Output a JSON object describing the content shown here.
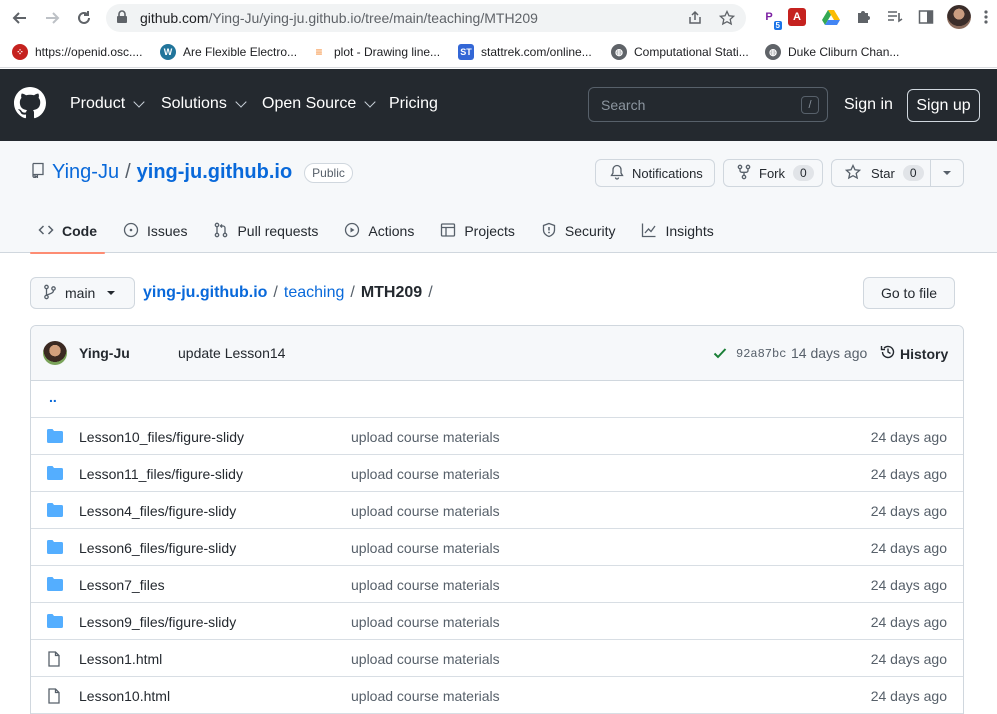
{
  "browser": {
    "url_host": "github.com",
    "url_path": "/Ying-Ju/ying-ju.github.io/tree/main/teaching/MTH209",
    "extension_badge": "5",
    "bookmarks": [
      {
        "label": "https://openid.osc....",
        "icon": "openid-icon",
        "color": "#c5221f"
      },
      {
        "label": "Are Flexible Electro...",
        "icon": "wordpress-icon",
        "color": "#21759b"
      },
      {
        "label": "plot - Drawing line...",
        "icon": "stackexchange-icon",
        "color": "#f48024"
      },
      {
        "label": "stattrek.com/online...",
        "icon": "stattrek-icon",
        "color": "#3367d6"
      },
      {
        "label": "Computational Stati...",
        "icon": "globe-icon",
        "color": "#5f6368"
      },
      {
        "label": "Duke Cliburn Chan...",
        "icon": "globe-icon",
        "color": "#5f6368"
      }
    ]
  },
  "header": {
    "nav": [
      "Product",
      "Solutions",
      "Open Source",
      "Pricing"
    ],
    "search_placeholder": "Search",
    "search_key": "/",
    "signin": "Sign in",
    "signup": "Sign up"
  },
  "repo": {
    "owner": "Ying-Ju",
    "separator": "/",
    "name": "ying-ju.github.io",
    "visibility": "Public",
    "notifications": "Notifications",
    "fork_label": "Fork",
    "fork_count": "0",
    "star_label": "Star",
    "star_count": "0",
    "tabs": [
      "Code",
      "Issues",
      "Pull requests",
      "Actions",
      "Projects",
      "Security",
      "Insights"
    ]
  },
  "path": {
    "branch": "main",
    "crumbs": [
      "ying-ju.github.io",
      "teaching",
      "MTH209"
    ],
    "goto_file": "Go to file"
  },
  "commit": {
    "author": "Ying-Ju",
    "message": "update Lesson14",
    "sha": "92a87bc",
    "when": "14 days ago",
    "history": "History"
  },
  "files": {
    "parent": "..",
    "rows": [
      {
        "name": "Lesson10_files/figure-slidy",
        "type": "folder",
        "message": "upload course materials",
        "age": "24 days ago"
      },
      {
        "name": "Lesson11_files/figure-slidy",
        "type": "folder",
        "message": "upload course materials",
        "age": "24 days ago"
      },
      {
        "name": "Lesson4_files/figure-slidy",
        "type": "folder",
        "message": "upload course materials",
        "age": "24 days ago"
      },
      {
        "name": "Lesson6_files/figure-slidy",
        "type": "folder",
        "message": "upload course materials",
        "age": "24 days ago"
      },
      {
        "name": "Lesson7_files",
        "type": "folder",
        "message": "upload course materials",
        "age": "24 days ago"
      },
      {
        "name": "Lesson9_files/figure-slidy",
        "type": "folder",
        "message": "upload course materials",
        "age": "24 days ago"
      },
      {
        "name": "Lesson1.html",
        "type": "file",
        "message": "upload course materials",
        "age": "24 days ago"
      },
      {
        "name": "Lesson10.html",
        "type": "file",
        "message": "upload course materials",
        "age": "24 days ago"
      }
    ]
  },
  "colors": {
    "header_bg": "#24292f",
    "link_blue": "#0969da",
    "folder_blue": "#54aeff",
    "tab_underline": "#fd8c73",
    "success_green": "#1a7f37"
  }
}
